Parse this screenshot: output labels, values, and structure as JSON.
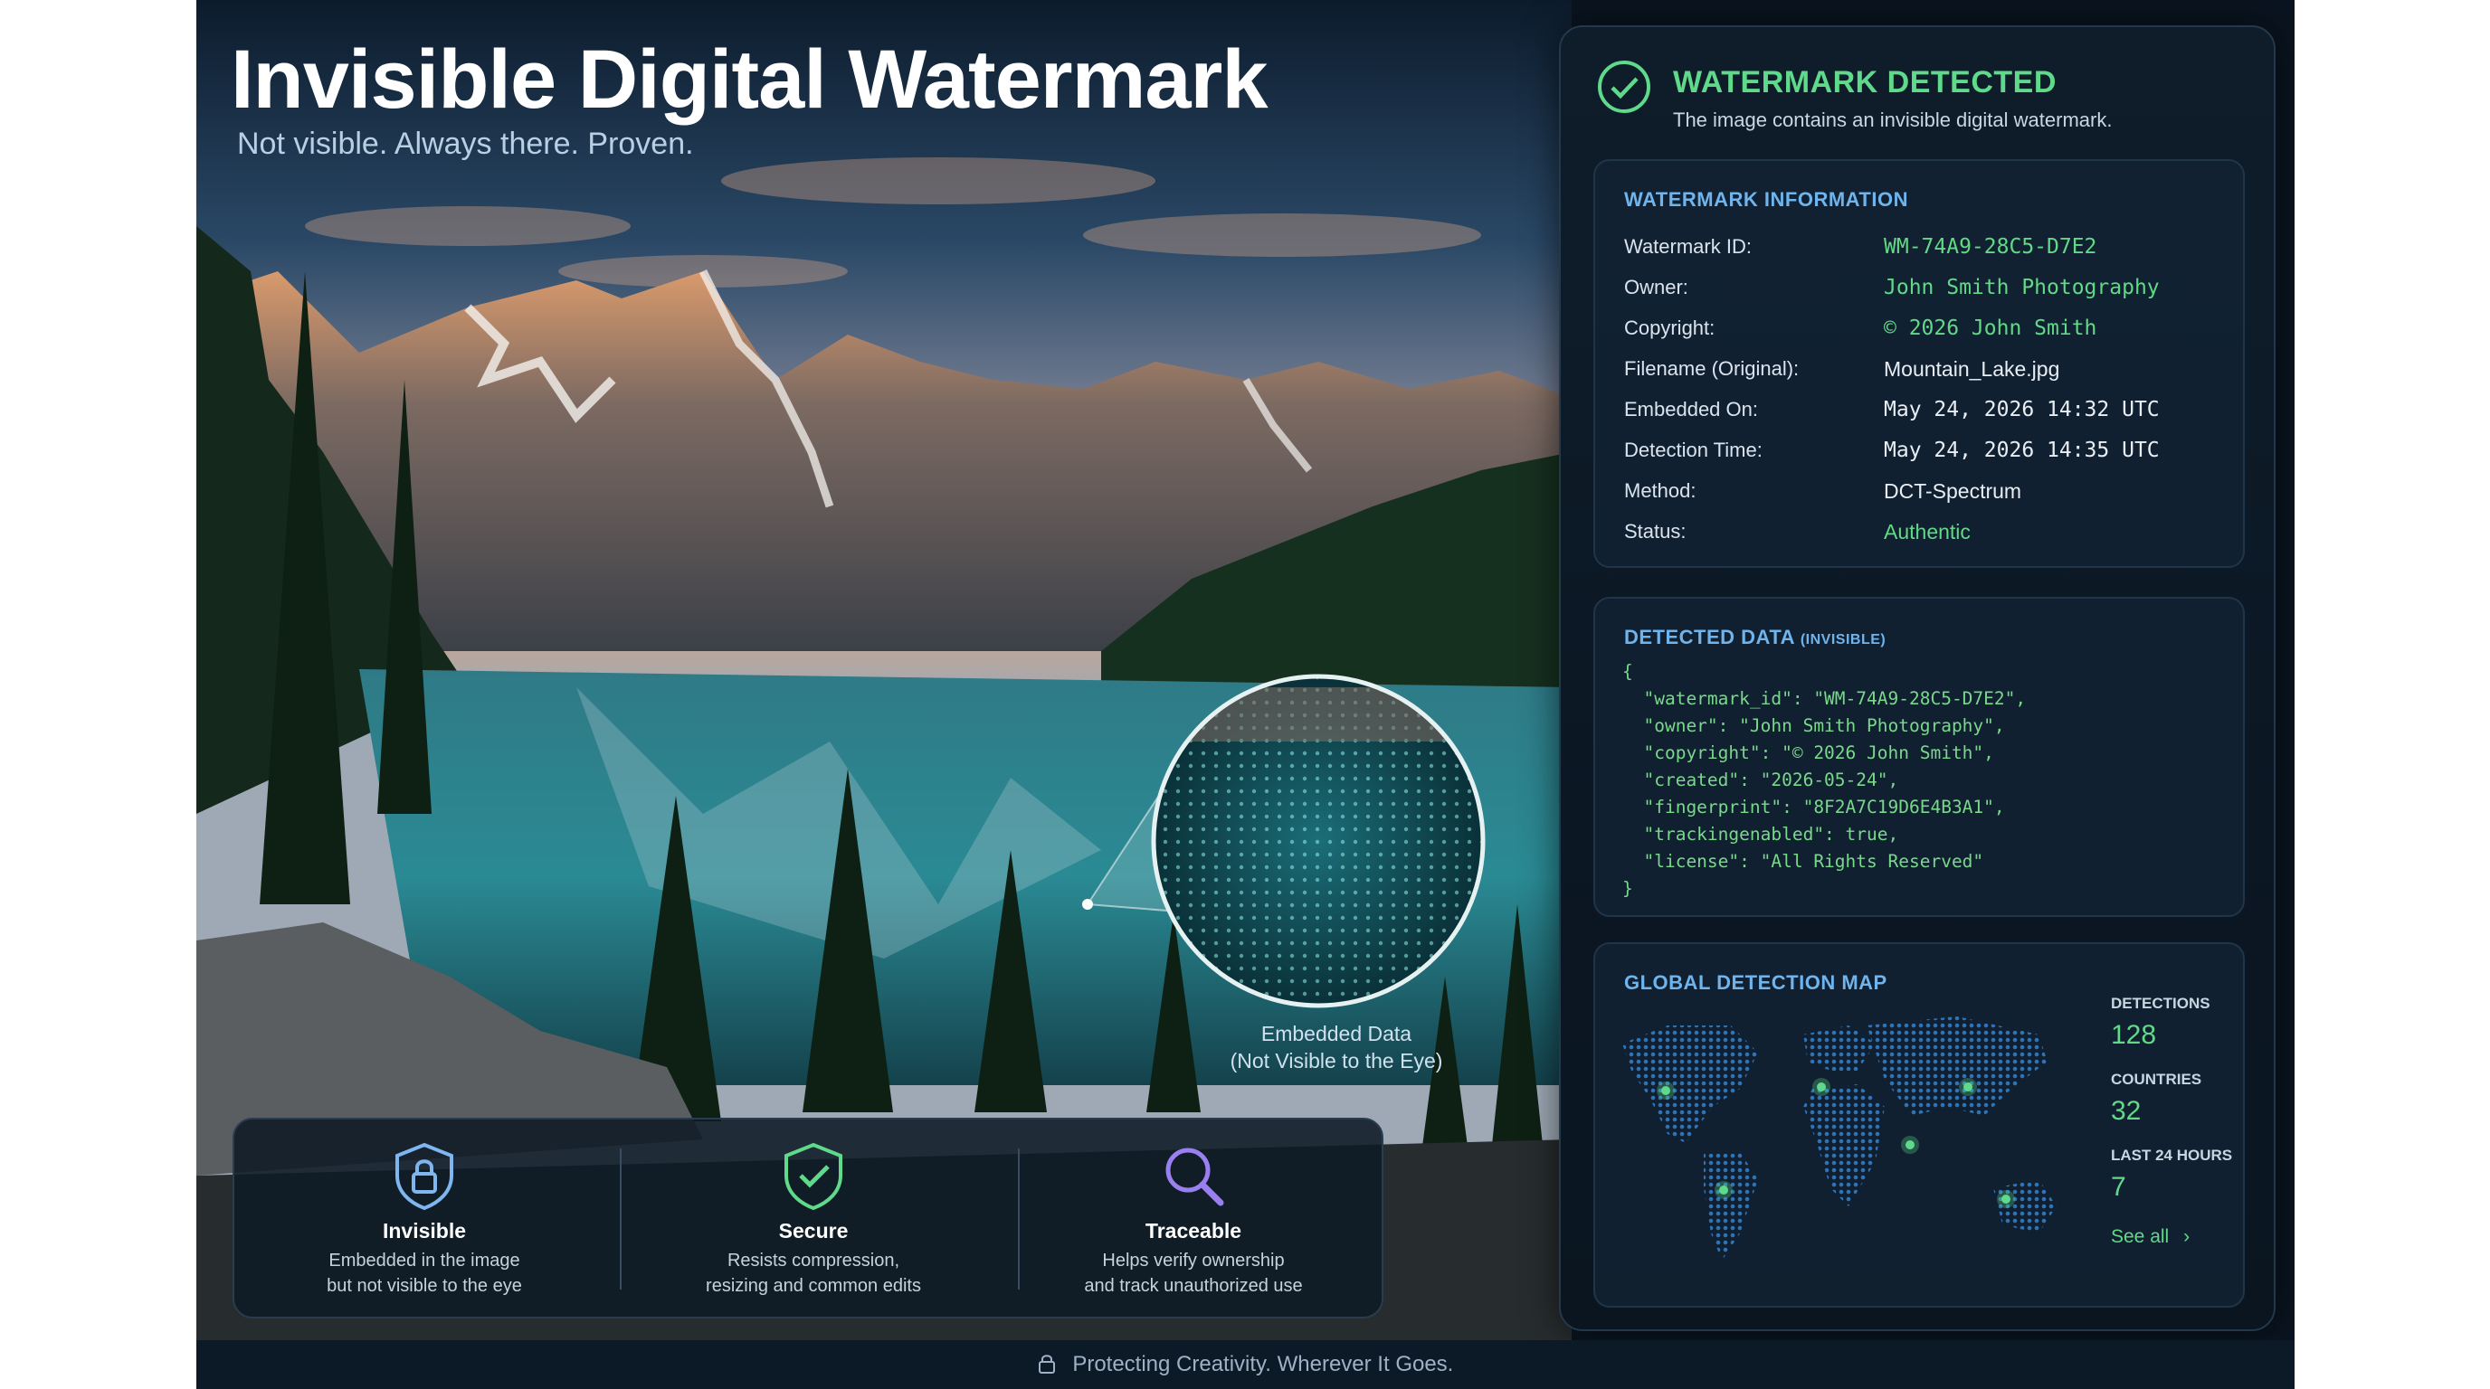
{
  "hero": {
    "title": "Invisible Digital Watermark",
    "subtitle": "Not visible. Always there. Proven."
  },
  "callout": {
    "line1": "Embedded Data",
    "line2": "(Not Visible to the Eye)"
  },
  "features": [
    {
      "icon": "lock-shield-icon",
      "title": "Invisible",
      "desc1": "Embedded in the image",
      "desc2": "but not visible to the eye"
    },
    {
      "icon": "check-shield-icon",
      "title": "Secure",
      "desc1": "Resists compression,",
      "desc2": "resizing and common edits"
    },
    {
      "icon": "magnifier-icon",
      "title": "Traceable",
      "desc1": "Helps verify ownership",
      "desc2": "and track unauthorized use"
    }
  ],
  "footer": {
    "text": "Protecting Creativity. Wherever It Goes.",
    "icon": "lock-icon"
  },
  "detection": {
    "title": "WATERMARK DETECTED",
    "subtitle": "The image contains an invisible digital watermark.",
    "icon": "check-circle-icon"
  },
  "info": {
    "title": "WATERMARK INFORMATION",
    "rows": [
      {
        "key": "Watermark ID:",
        "value": "WM-74A9-28C5-D7E2"
      },
      {
        "key": "Owner:",
        "value": "John Smith Photography"
      },
      {
        "key": "Copyright:",
        "value": "© 2026 John Smith"
      },
      {
        "key": "Filename (Original):",
        "value": "Mountain_Lake.jpg"
      },
      {
        "key": "Embedded On:",
        "value": "May 24, 2026 14:32 UTC"
      },
      {
        "key": "Detection Time:",
        "value": "May 24, 2026 14:35 UTC"
      },
      {
        "key": "Method:",
        "value": "DCT-Spectrum"
      },
      {
        "key": "Status:",
        "value": "Authentic"
      }
    ]
  },
  "detected": {
    "title": "DETECTED DATA",
    "title_small": "(INVISIBLE)",
    "code": "{\n  \"watermark_id\": \"WM-74A9-28C5-D7E2\",\n  \"owner\": \"John Smith Photography\",\n  \"copyright\": \"© 2026 John Smith\",\n  \"created\": \"2026-05-24\",\n  \"fingerprint\": \"8F2A7C19D6E4B3A1\",\n  \"trackingenabled\": true,\n  \"license\": \"All Rights Reserved\"\n}"
  },
  "map": {
    "title": "GLOBAL DETECTION MAP",
    "stats": [
      {
        "label": "DETECTIONS",
        "value": "128"
      },
      {
        "label": "COUNTRIES",
        "value": "32"
      },
      {
        "label": "LAST 24 HOURS",
        "value": "7"
      }
    ],
    "see_all": "See all",
    "see_all_icon": "chevron-right-icon"
  },
  "colors": {
    "accent_green": "#5fd98a",
    "accent_blue": "#6fb4ec",
    "panel_bg": "#0f1d2b"
  }
}
